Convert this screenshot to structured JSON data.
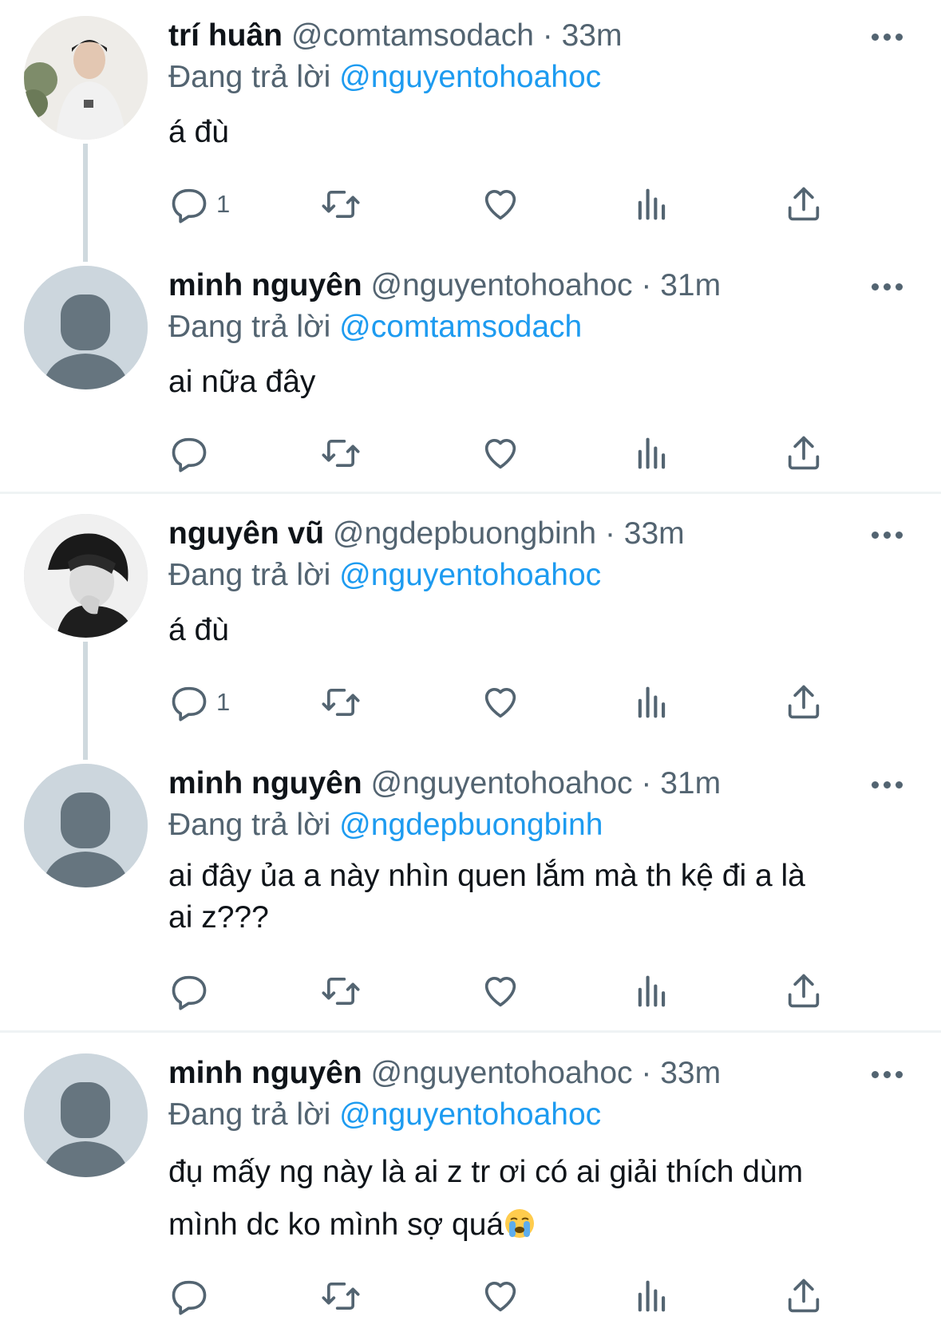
{
  "tweets": [
    {
      "name": "trí huân",
      "handle": "@comtamsodach",
      "time": "33m",
      "reply_prefix": "Đang trả lời",
      "reply_to": "@nguyentohoahoc",
      "text": "á đù",
      "reply_count": "1"
    },
    {
      "name": "minh nguyên",
      "handle": "@nguyentohoahoc",
      "time": "31m",
      "reply_prefix": "Đang trả lời",
      "reply_to": "@comtamsodach",
      "text": "ai nữa đây",
      "reply_count": ""
    },
    {
      "name": "nguyên vũ",
      "handle": "@ngdepbuongbinh",
      "time": "33m",
      "reply_prefix": "Đang trả lời",
      "reply_to": "@nguyentohoahoc",
      "text": "á đù",
      "reply_count": "1"
    },
    {
      "name": "minh nguyên",
      "handle": "@nguyentohoahoc",
      "time": "31m",
      "reply_prefix": "Đang trả lời",
      "reply_to": "@ngdepbuongbinh",
      "text_line1": "ai đây ủa a này nhìn quen lắm mà th kệ đi a là",
      "text_line2": "ai z???",
      "reply_count": ""
    },
    {
      "name": "minh nguyên",
      "handle": "@nguyentohoahoc",
      "time": "33m",
      "reply_prefix": "Đang trả lời",
      "reply_to": "@nguyentohoahoc",
      "text_line1": "đụ mấy ng này là ai z tr ơi có ai giải thích dùm",
      "text_line2": "mình dc ko mình sợ quá",
      "reply_count": ""
    }
  ],
  "icons": {
    "reply": "reply-icon",
    "retweet": "retweet-icon",
    "like": "heart-icon",
    "views": "views-icon",
    "share": "share-icon",
    "more": "more-icon",
    "emoji": "crying-face-emoji"
  },
  "colors": {
    "mention": "#1d9bf0",
    "secondary": "#536471",
    "thread_line": "#cfd9de"
  }
}
